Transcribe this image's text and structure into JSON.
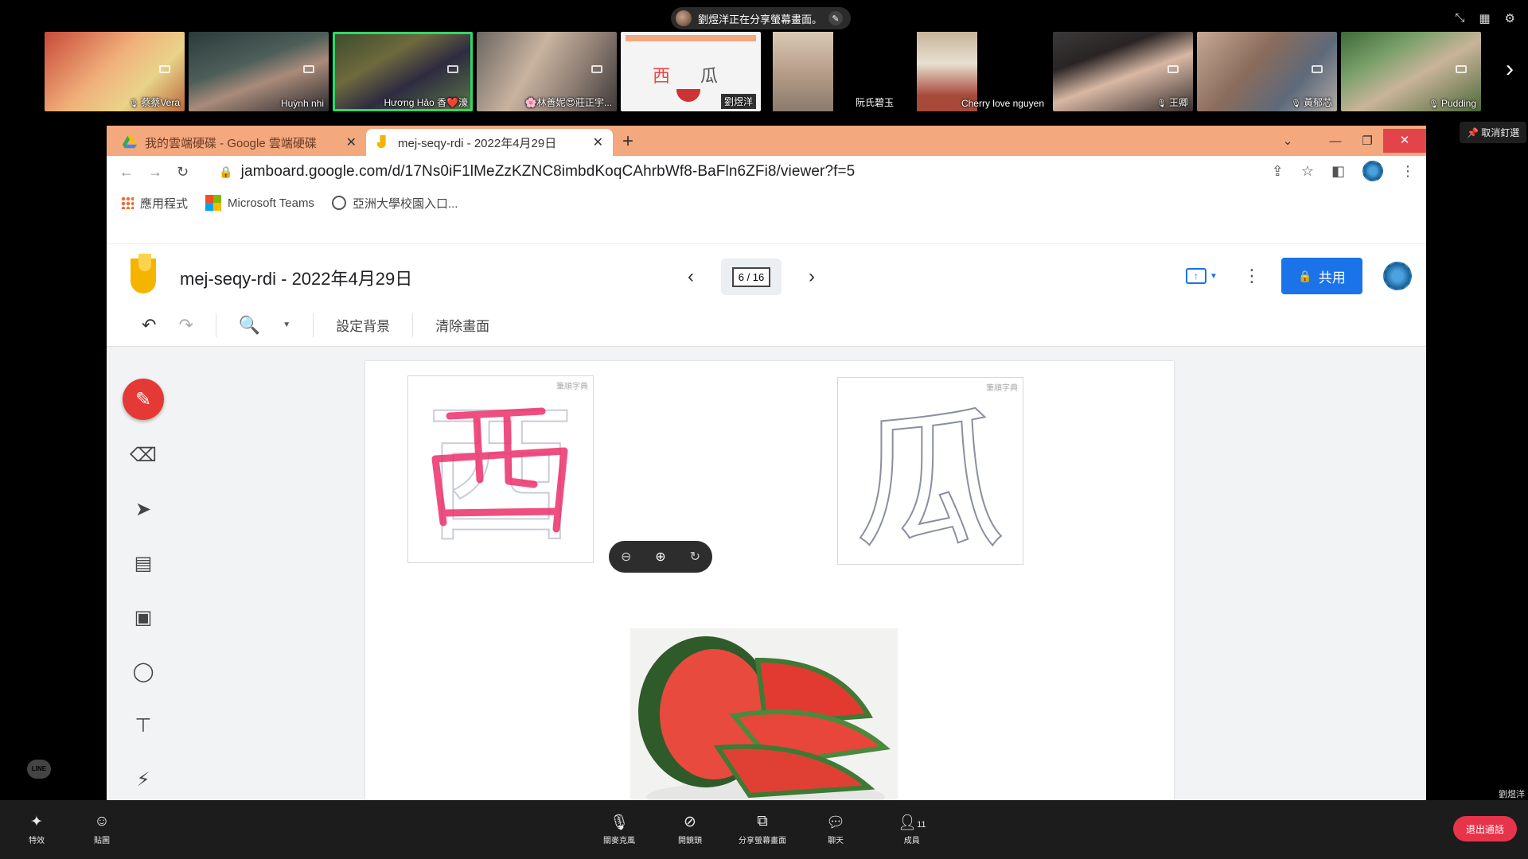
{
  "meeting": {
    "share_banner": "劉煜洋正在分享螢幕畫面。",
    "unpin_label": "取消釘選",
    "presenter_label": "劉煜洋",
    "participants": [
      {
        "name": "蔡蔡Vera",
        "muted": true
      },
      {
        "name": "Huỳnh nhi",
        "muted": false
      },
      {
        "name": "Hương Hảo 香❤️濠",
        "muted": false,
        "speaking": true
      },
      {
        "name": "🌸林善妮😍莊正宇...",
        "muted": false
      },
      {
        "name": "劉煜洋",
        "muted": false
      },
      {
        "name": "阮氏碧玉",
        "muted": false
      },
      {
        "name": "Cherry love nguyen",
        "muted": false
      },
      {
        "name": "王卿",
        "muted": true
      },
      {
        "name": "黃郁芯",
        "muted": true
      },
      {
        "name": "Pudding",
        "muted": true
      }
    ],
    "bottom_bar": {
      "effects": "特效",
      "stickers": "貼圖",
      "mic": "關麥克風",
      "camera": "開鏡頭",
      "share_screen": "分享螢幕畫面",
      "chat": "聊天",
      "members": "成員",
      "member_count": "11",
      "leave": "退出通話"
    }
  },
  "browser": {
    "tabs": [
      {
        "label": "我的雲端硬碟 - Google 雲端硬碟",
        "active": false
      },
      {
        "label": "mej-seqy-rdi - 2022年4月29日",
        "active": true
      }
    ],
    "url": "jamboard.google.com/d/17Ns0iF1lMeZzKZNC8imbdKoqCAhrbWf8-BaFln6ZFi8/viewer?f=5",
    "bookmarks": [
      "應用程式",
      "Microsoft Teams",
      "亞洲大學校園入口..."
    ]
  },
  "jamboard": {
    "title": "mej-seqy-rdi - 2022年4月29日",
    "frame_indicator": "6 / 16",
    "share_label": "共用",
    "toolbar": {
      "set_background": "設定背景",
      "clear_frame": "清除畫面"
    },
    "cards": [
      {
        "character": "西",
        "watermark": "筆順字典"
      },
      {
        "character": "瓜",
        "watermark": "筆順字典"
      }
    ],
    "tools": [
      "pen-icon",
      "eraser-icon",
      "select-icon",
      "sticky-note-icon",
      "image-icon",
      "circle-icon",
      "text-box-icon",
      "laser-icon"
    ]
  },
  "colors": {
    "tab_bar": "#f3a87e",
    "share_button": "#1a73e8",
    "pen_tool": "#e53935",
    "leave_button": "#e8344a",
    "stroke_pink": "#ec2f6a",
    "speaking_outline": "#2fd86a"
  }
}
